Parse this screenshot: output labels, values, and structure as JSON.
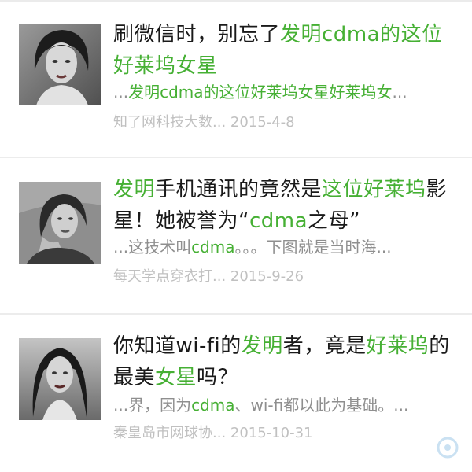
{
  "results": [
    {
      "title": [
        {
          "t": "刷微信时，别忘了",
          "hl": false
        },
        {
          "t": "发明cdma的这位好莱坞女星",
          "hl": true
        }
      ],
      "snippet": [
        {
          "t": "...",
          "hl": false
        },
        {
          "t": "发明cdma的这位好莱坞女星好莱坞女",
          "hl": true
        },
        {
          "t": "...",
          "hl": false
        }
      ],
      "source": "知了网科技大数...",
      "date": "2015-4-8"
    },
    {
      "title": [
        {
          "t": "发明",
          "hl": true
        },
        {
          "t": "手机通讯的竟然是",
          "hl": false
        },
        {
          "t": "这位好莱坞",
          "hl": true
        },
        {
          "t": "影星！她被誉为“",
          "hl": false
        },
        {
          "t": "cdma",
          "hl": true
        },
        {
          "t": "之母”",
          "hl": false
        }
      ],
      "snippet": [
        {
          "t": "...这技术叫",
          "hl": false
        },
        {
          "t": "cdma",
          "hl": true
        },
        {
          "t": "。。。下图就是当时海...",
          "hl": false
        }
      ],
      "source": "每天学点穿衣打...",
      "date": "2015-9-26"
    },
    {
      "title": [
        {
          "t": "你知道wi-fi的",
          "hl": false
        },
        {
          "t": "发明",
          "hl": true
        },
        {
          "t": "者，竟是",
          "hl": false
        },
        {
          "t": "好莱坞",
          "hl": true
        },
        {
          "t": "的最美",
          "hl": false
        },
        {
          "t": "女星",
          "hl": true
        },
        {
          "t": "吗？",
          "hl": false
        }
      ],
      "snippet": [
        {
          "t": "...界，因为",
          "hl": false
        },
        {
          "t": "cdma",
          "hl": true
        },
        {
          "t": "、wi-fi都以此为基础。...",
          "hl": false
        }
      ],
      "source": "秦皇岛市网球协...",
      "date": "2015-10-31"
    }
  ],
  "colors": {
    "highlight": "#46b034",
    "title": "#1a1a1a",
    "snippet": "#8f8f8f",
    "meta": "#c0c0c0"
  },
  "thumb_icons": [
    "portrait-photo-1",
    "portrait-photo-2",
    "portrait-photo-3"
  ]
}
